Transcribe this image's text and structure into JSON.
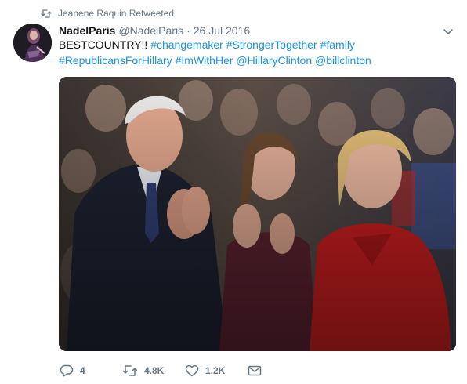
{
  "retweet_context": {
    "icon": "retweet-icon",
    "text": "Jeanene Raquin Retweeted"
  },
  "tweet": {
    "author_name": "NadelParis",
    "author_handle": "@NadelParis",
    "separator": "·",
    "date": "26 Jul 2016",
    "text_plain": "BESTCOUNTRY!!",
    "hashtags_line1": [
      "#changemaker",
      "#StrongerTogether",
      "#family"
    ],
    "hashtags_line2": [
      "#RepublicansForHillary",
      "#ImWithHer"
    ],
    "mentions": [
      "@HillaryClinton",
      "@billclinton"
    ],
    "menu_icon": "chevron-down-icon",
    "media_icon": "photo-icon"
  },
  "actions": {
    "reply_count": "4",
    "retweet_count": "4.8K",
    "like_count": "1.2K",
    "icons": [
      "reply-icon",
      "retweet-icon",
      "heart-icon",
      "envelope-icon"
    ]
  },
  "colors": {
    "link": "#1b95e0",
    "secondary_text": "#657786",
    "primary_text": "#14171a"
  }
}
